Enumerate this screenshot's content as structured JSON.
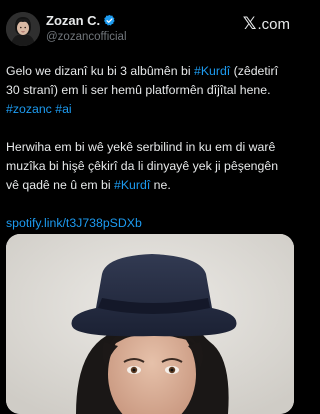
{
  "author": {
    "display_name": "Zozan C.",
    "handle": "@zozancofficial",
    "verified_icon": "verified-badge-icon",
    "verified_color": "#1d9bf0"
  },
  "watermark": {
    "mark": "𝕏",
    "text": ".com"
  },
  "tweet": {
    "p1_text_a": "Gelo we dizanî ku bi 3 albûmên bi ",
    "p1_hashtag_kurdi": "#Kurdî",
    "p1_text_b": " (zêdetirî 30 stranî) em li ser hemû platformên dîjîtal hene. ",
    "p1_hashtag_zozanc": "#zozanc",
    "p1_hashtag_ai": "#ai",
    "p2_text_a": "Herwiha em bi wê yekê serbilind in ku em di warê muzîka bi hişê çêkirî da li dinyayê yek ji pêşengên vê qadê ne û em bi ",
    "p2_hashtag_kurdi": "#Kurdî",
    "p2_text_b": " ne.",
    "link": "spotify.link/t3J738pSDXb"
  },
  "colors": {
    "background": "#000000",
    "text": "#e7e9ea",
    "secondary": "#71767b",
    "accent": "#1d9bf0"
  }
}
